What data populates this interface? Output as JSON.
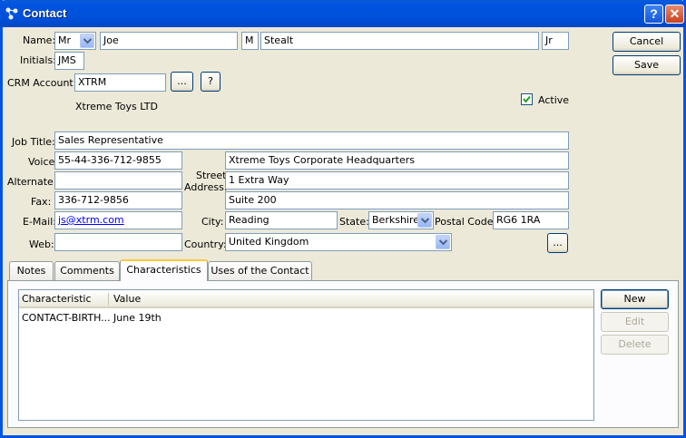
{
  "window": {
    "title": "Contact",
    "help_glyph": "?",
    "close_glyph": "✕"
  },
  "buttons": {
    "cancel": "Cancel",
    "save": "Save",
    "new": "New",
    "edit": "Edit",
    "delete": "Delete",
    "ellipsis": "...",
    "question": "?"
  },
  "name": {
    "label": "Name:",
    "honorific": "Mr",
    "first": "Joe",
    "middle": "M",
    "last": "Stealt",
    "suffix": "Jr"
  },
  "initials": {
    "label": "Initials:",
    "value": "JMS"
  },
  "crm": {
    "label": "CRM Account:",
    "value": "XTRM",
    "description": "Xtreme Toys LTD"
  },
  "active": {
    "label": "Active",
    "checked": true
  },
  "job_title": {
    "label": "Job Title:",
    "value": "Sales Representative"
  },
  "voice": {
    "label": "Voice:",
    "value": "55-44-336-712-9855"
  },
  "alternate": {
    "label": "Alternate:",
    "value": ""
  },
  "fax": {
    "label": "Fax:",
    "value": "336-712-9856"
  },
  "email": {
    "label": "E-Mail:",
    "value": "js@xtrm.com"
  },
  "web": {
    "label": "Web:",
    "value": ""
  },
  "address": {
    "street_label_1": "Street",
    "street_label_2": "Address:",
    "line1": "Xtreme Toys Corporate Headquarters",
    "line2": "1 Extra Way",
    "line3": "Suite 200",
    "city_label": "City:",
    "city": "Reading",
    "state_label": "State:",
    "state": "Berkshire",
    "postal_label": "Postal Code:",
    "postal": "RG6 1RA",
    "country_label": "Country:",
    "country": "United Kingdom"
  },
  "tabs": [
    {
      "label": "Notes"
    },
    {
      "label": "Comments"
    },
    {
      "label": "Characteristics"
    },
    {
      "label": "Uses of the Contact"
    }
  ],
  "active_tab": "Characteristics",
  "characteristics": {
    "columns": [
      "Characteristic",
      "Value"
    ],
    "rows": [
      {
        "characteristic": "CONTACT-BIRTH...",
        "value": "June 19th"
      }
    ]
  },
  "colors": {
    "titlebar": "#0054e3",
    "window_bg": "#ece9d8",
    "tab_highlight": "#ffc83c"
  },
  "icons": {
    "app": "network-icon",
    "dropdown": "chevron-down-icon",
    "check": "checkmark-icon"
  }
}
